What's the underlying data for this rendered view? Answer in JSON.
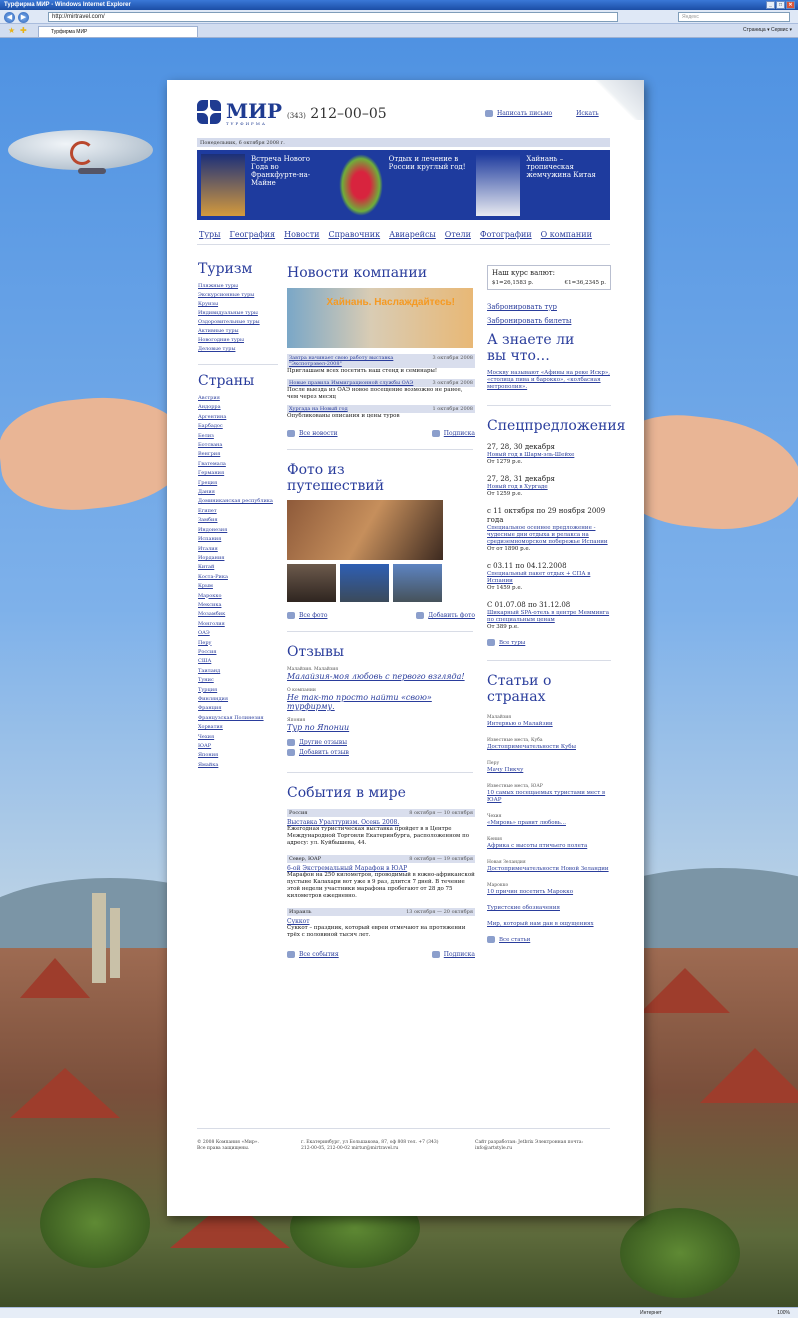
{
  "browser": {
    "title": "Турфирма МИР - Windows Internet Explorer",
    "url": "http://mirtravel.com/",
    "search_placeholder": "Яндекс",
    "tab_label": "Турфирма МИР",
    "tools": "Страница ▾  Сервис ▾",
    "status_zone": "Интернет",
    "zoom": "100%"
  },
  "header": {
    "logo_name": "МИР",
    "logo_sub": "ТУРФИРМА",
    "phone_code": "(343)",
    "phone": "212–00–05",
    "write_link": "Написать письмо",
    "search_link": "Искать",
    "date": "Понедельник, 6 октября 2008 г."
  },
  "banner": [
    "Встреча Нового Года во Франкфурте-на-Майне",
    "Отдых и лечение в России круглый год!",
    "Хайнань – тропическая жемчужина Китая"
  ],
  "nav": [
    "Туры",
    "География",
    "Новости",
    "Справочник",
    "Авиарейсы",
    "Отели",
    "Фотографии",
    "О компании"
  ],
  "tourism": {
    "title": "Туризм",
    "items": [
      "Пляжные туры",
      "Экскурсионные туры",
      "Круизы",
      "Индивидуальные туры",
      "Оздоровительные туры",
      "Активные туры",
      "Новогодние туры",
      "Деловые туры"
    ]
  },
  "countries": {
    "title": "Страны",
    "items": [
      "Австрия",
      "Андорра",
      "Аргентина",
      "Барбадос",
      "Белиз",
      "Ботсвана",
      "Венгрия",
      "Гватемала",
      "Германия",
      "Греция",
      "Дания",
      "Доминиканская республика",
      "Египет",
      "Замбия",
      "Индонезия",
      "Испания",
      "Италия",
      "Иордания",
      "Китай",
      "Коста-Рика",
      "Крым",
      "Марокко",
      "Мексика",
      "Мозамбик",
      "Монголия",
      "ОАЭ",
      "Перу",
      "Россия",
      "США",
      "Таиланд",
      "Тунис",
      "Турция",
      "Финляндия",
      "Франция",
      "Французская Полинезия",
      "Хорватия",
      "Чехия",
      "ЮАР",
      "Япония",
      "Ямайка"
    ]
  },
  "news": {
    "title": "Новости компании",
    "img_text": "Хайнань. Наслаждайтесь!",
    "items": [
      {
        "title": "Завтра начинает свою работу выставка \"Экспотрэвел-2008\"",
        "date": "3 октября 2008",
        "text": "Приглашаем всех посетить наш стенд и семинары!"
      },
      {
        "title": "Новые правила Иммиграционной службы ОАЭ",
        "date": "3 октября 2008",
        "text": "После выезда из ОАЭ новое посещение возможно не ранее, чем через месяц"
      },
      {
        "title": "Хургада на Новый год",
        "date": "1 октября 2008",
        "text": "Опубликованы описания и цены туров"
      }
    ],
    "all": "Все новости",
    "subscribe": "Подписка"
  },
  "photos": {
    "title": "Фото из путешествий",
    "all": "Все фото",
    "add": "Добавить фото"
  },
  "reviews": {
    "title": "Отзывы",
    "items": [
      {
        "cat": "Малайзия. Малайзия",
        "text": "Малайзия-моя любовь с первого взгляда!"
      },
      {
        "cat": "О компании",
        "text": "Не так-то просто найти «свою» турфирму."
      },
      {
        "cat": "Япония",
        "text": "Тур по Японии"
      }
    ],
    "other": "Другие отзывы",
    "add": "Добавить отзыв"
  },
  "events": {
    "title": "События в мире",
    "items": [
      {
        "place": "Россия",
        "date": "8 октября — 10 октября",
        "title": "Выставка Уралтуризм. Осень 2008.",
        "text": "Ежегодная туристическая выставка пройдет в в Центре Международной Торговли Екатеринбурга, расположенном по адресу: ул. Куйбышева, 44."
      },
      {
        "place": "Север, ЮАР",
        "date": "8 октября — 19 октября",
        "title": "6-ой Экстремальный Марафон в ЮАР",
        "text": "Марафон на 250 километров, проводимый в южно-африканской пустыне Калахари вот уже в 9 раз, длится 7 дней. В течение этой недели участники марафона пробегают от 28 до 75 километров ежедневно."
      },
      {
        "place": "Израиль",
        "date": "13 октября — 20 октября",
        "title": "Суккот",
        "text": "Суккот – праздник, который евреи отмечают на протяжении трёх с половиной тысяч лет."
      }
    ],
    "all": "Все события",
    "subscribe": "Подписка"
  },
  "rates": {
    "title": "Наш курс валют:",
    "usd": "$1=26,1583 р.",
    "eur": "€1=36,2345 р."
  },
  "book": [
    "Забронировать тур",
    "Забронировать билеты"
  ],
  "know": {
    "title": "А знаете ли вы что…",
    "text": "Москву называют «Афины на реке Искр», «столица пива и барокко», «колбасная метрополия»."
  },
  "offers": {
    "title": "Спецпредложения",
    "items": [
      {
        "date": "27, 28, 30 декабря",
        "link": "Новый год в Шарм-эль-Шейхе",
        "price": "От 1279 р.е."
      },
      {
        "date": "27, 28, 31 декабря",
        "link": "Новый год в Хургаде",
        "price": "От 1259 р.е."
      },
      {
        "date": "с 11 октября по 29 ноября 2009 года",
        "link": "Специальное осеннее предложение - чудесные дни отдыха и релакса на средиземноморском побережье Испании",
        "price": "От от 1890 р.е."
      },
      {
        "date": "с 03.11 по 04.12.2008",
        "link": "Специальный пакет отдых + СПА в Испании",
        "price": "От 1459 р.е."
      },
      {
        "date": "С 01.07.08 по 31.12.08",
        "link": "Шикарный SPA-отель в центре Мемминга по специальным ценам",
        "price": "От 389 р.е."
      }
    ],
    "all": "Все туры"
  },
  "articles": {
    "title": "Статьи о странах",
    "items": [
      {
        "cat": "Малайзия",
        "link": "Интервью о Малайзии"
      },
      {
        "cat": "Известные места, Куба",
        "link": "Достопримечательности Кубы"
      },
      {
        "cat": "Перу",
        "link": "Мачу Пикчу"
      },
      {
        "cat": "Известные места, ЮАР",
        "link": "10 самых посещаемых туристами мест в ЮАР"
      },
      {
        "cat": "Чехия",
        "link": "«Мировь» правит любовь..."
      },
      {
        "cat": "Кения",
        "link": "Африка с высоты птичьего полета"
      },
      {
        "cat": "Новая Зеландия",
        "link": "Достопримечательности Новой Зеландии"
      },
      {
        "cat": "Марокко",
        "link": "10 причин посетить Марокко"
      },
      {
        "cat": "",
        "link": "Туристские обозначения"
      },
      {
        "cat": "",
        "link": "Мир, который нам дан в ощущениях"
      }
    ],
    "all": "Все статьи"
  },
  "footer": {
    "copy": "© 2008 Компания «Мир». Все права защищены.",
    "address": "г. Екатеринбург, ул Большакова, 87, оф 808 тел. +7 (343) 212-00-05, 212-00-02 mirtur@mirtravel.ru",
    "dev": "Сайт разработан: Jetbrix Электронная почта: info@artstyle.ru"
  }
}
